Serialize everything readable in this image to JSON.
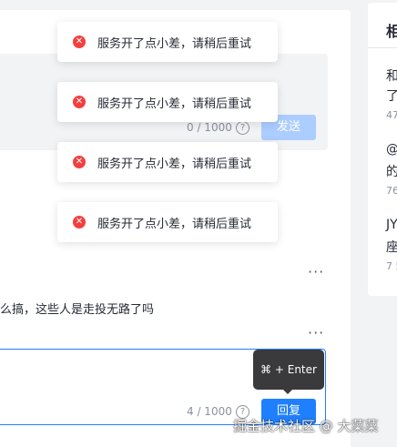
{
  "toasts": [
    {
      "icon": "close-circle-icon",
      "text": "服务开了点小差，请稍后重试"
    },
    {
      "icon": "close-circle-icon",
      "text": "服务开了点小差，请稍后重试"
    },
    {
      "icon": "close-circle-icon",
      "text": "服务开了点小差，请稍后重试"
    },
    {
      "icon": "close-circle-icon",
      "text": "服务开了点小差，请稍后重试"
    }
  ],
  "comment_input": {
    "counter": "0 / 1000",
    "help_glyph": "?",
    "send_label": "发送"
  },
  "comment": {
    "text_fragment": "么搞，这些人是走投无路了吗",
    "more_glyph": "···"
  },
  "reply_input": {
    "counter": "4 / 1000",
    "help_glyph": "?",
    "submit_label": "回复",
    "shortcut_tooltip": "⌘ + Enter"
  },
  "sidebar": {
    "title_fragment": "相",
    "items": [
      {
        "line1": "和",
        "line2": "了",
        "meta": "47"
      },
      {
        "line1": "@",
        "line2": "的",
        "meta": "76"
      },
      {
        "line1": "JY",
        "line2": "座",
        "meta": "7 5"
      }
    ]
  },
  "watermark": "掘金技术社区 @ 大菜菜",
  "colors": {
    "accent": "#1e80ff",
    "accent_disabled": "#abcdff",
    "error": "#f53f3f",
    "background": "#f2f3f5"
  }
}
